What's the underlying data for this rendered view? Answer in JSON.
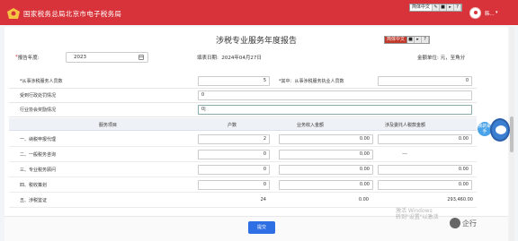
{
  "header": {
    "site_title": "国家税务总局北京市电子税务局",
    "tool_label": "简体中文",
    "tool_buttons": [
      "✎",
      "■",
      "▸",
      "?"
    ],
    "user_name": "韩...",
    "user_caret": "▾",
    "brand_color": "#d8333a"
  },
  "report": {
    "title": "涉税专业服务年度报告",
    "tool_label": "简体中文",
    "tool_buttons": [
      "■",
      "▸",
      "?"
    ],
    "year_label": "报告年度:",
    "year_value": "2023",
    "fill_date_label": "填表日期:",
    "fill_date_value": "2024年04月27日",
    "amount_unit": "金额单位: 元，至角分"
  },
  "form": {
    "staff_label": "*从事涉税服务人员数",
    "staff_value": "5",
    "staff_sub_label": "*其中：从事涉税服务执业人员数",
    "staff_sub_value": "0",
    "penalty_label": "受到行政处罚情况",
    "penalty_value": "0",
    "award_label": "行业协会奖励情况",
    "award_value": "0|"
  },
  "table": {
    "headers": [
      "服务项目",
      "户数",
      "业务收入金额",
      "涉及委托人税款金额"
    ],
    "rows": [
      {
        "label": "一、纳税申报代理",
        "count": "2",
        "income": "0.00",
        "tax": "0.00"
      },
      {
        "label": "二、一般税务咨询",
        "count": "0",
        "income": "0.00",
        "tax": "---"
      },
      {
        "label": "三、专业税务顾问",
        "count": "0",
        "income": "0.00",
        "tax": "0.00"
      },
      {
        "label": "四、税收策划",
        "count": "0",
        "income": "0.00",
        "tax": "0.00"
      },
      {
        "label": "五、涉税鉴证",
        "count": "24",
        "income": "0.00",
        "tax": "293,460.00"
      }
    ]
  },
  "submit_label": "提交",
  "mascot_text": "我的助手",
  "watermark": {
    "windows_line1": "激活 Windows",
    "windows_line2": "转到\"设置\"以激活",
    "brand": "企行"
  }
}
